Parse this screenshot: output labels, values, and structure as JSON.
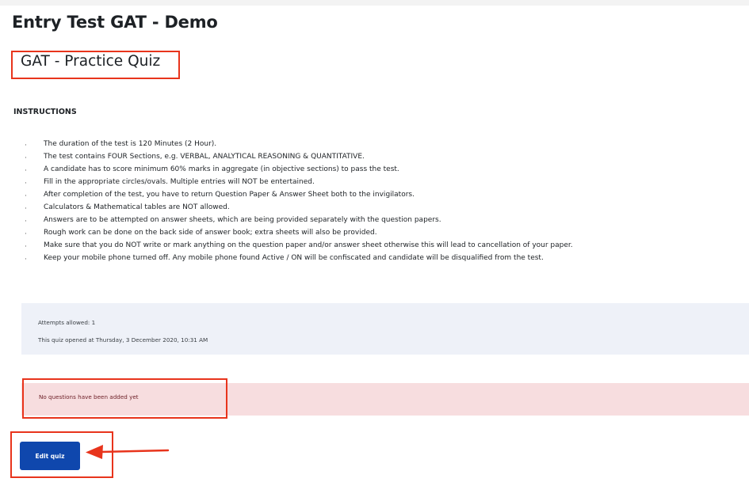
{
  "course": {
    "title": "Entry Test GAT - Demo"
  },
  "quiz": {
    "title": "GAT - Practice Quiz"
  },
  "instructions": {
    "heading": "INSTRUCTIONS",
    "items": [
      "The duration of the test is 120 Minutes (2 Hour).",
      "The test contains FOUR Sections, e.g. VERBAL, ANALYTICAL REASONING & QUANTITATIVE.",
      "A candidate has to score minimum 60% marks in aggregate (in objective sections) to pass the test.",
      "Fill in the appropriate circles/ovals. Multiple entries will NOT be entertained.",
      "After completion of the test, you have to return Question Paper & Answer Sheet both to the invigilators.",
      "Calculators & Mathematical tables are NOT allowed.",
      "Answers are to be attempted on answer sheets, which are being provided separately with the question papers.",
      "Rough work can be done on the back side of answer book; extra sheets will also be provided.",
      "Make sure that you do NOT write or mark anything on the question paper and/or answer sheet otherwise this will lead to cancellation of your paper.",
      "Keep your mobile phone turned off. Any mobile phone found Active / ON will be confiscated and candidate will be disqualified from the test."
    ]
  },
  "quiz_info": {
    "attempts": "Attempts allowed: 1",
    "opened": "This quiz opened at Thursday, 3 December 2020, 10:31 AM"
  },
  "alert": {
    "message": "No questions have been added yet"
  },
  "actions": {
    "edit_quiz_label": "Edit quiz"
  },
  "colors": {
    "highlight": "#e8341c",
    "primary_button": "#0f47ad",
    "info_background": "#eef1f8",
    "alert_background": "#f7dddf"
  },
  "icons": {
    "annotation_arrow": "arrow-left-icon",
    "bullet": "bullet-dot-icon"
  }
}
